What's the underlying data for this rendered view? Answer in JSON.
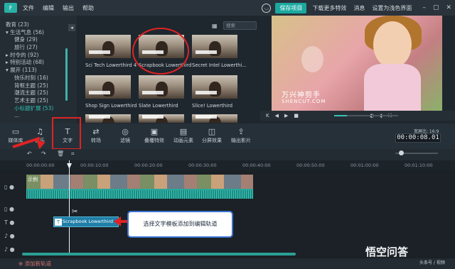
{
  "menubar": {
    "logo": "F",
    "menus": [
      "文件",
      "编辑",
      "输出",
      "帮助"
    ],
    "save_project": "保存项目",
    "download_effects": "下载更多特效",
    "messages": "消息",
    "simple_mode": "设置为浅色界面"
  },
  "sidebar": {
    "collapse_icon": "◂",
    "items": [
      {
        "label": "教育 (23)",
        "indent": 0
      },
      {
        "label": "▾ 生活气息 (56)",
        "indent": 0
      },
      {
        "label": "健身 (29)",
        "indent": 1
      },
      {
        "label": "旅行 (27)",
        "indent": 1
      },
      {
        "label": "▸ 时令的 (92)",
        "indent": 0
      },
      {
        "label": "▸ 特别活动 (68)",
        "indent": 0
      },
      {
        "label": "▾ 展开 (113)",
        "indent": 0
      },
      {
        "label": "快乐时刻 (16)",
        "indent": 1
      },
      {
        "label": "背框主题 (25)",
        "indent": 1
      },
      {
        "label": "潮流主题 (25)",
        "indent": 1
      },
      {
        "label": "艺术主题 (25)",
        "indent": 1
      },
      {
        "label": "小标题扩展 (53)",
        "indent": 1,
        "selected": true
      },
      {
        "label": "...",
        "indent": 1
      }
    ]
  },
  "library": {
    "search_placeholder": "搜索",
    "grid_icon": "▦",
    "thumbnails": [
      {
        "label": "Sci Tech Lowerthird 4"
      },
      {
        "label": "Scrapbook Lowerthird"
      },
      {
        "label": "Secret Intel Lowerthi..."
      },
      {
        "label": "Shop Sign Lowerthird"
      },
      {
        "label": "Slate Lowerthird"
      },
      {
        "label": "Slice! Lowerthird"
      }
    ]
  },
  "preview": {
    "overlay_title": "万兴神剪手",
    "overlay_sub": "SHENCUT.COM",
    "controls": [
      "K",
      "◀",
      "▶",
      "■",
      "▏",
      "◐",
      "◖",
      "⛶"
    ],
    "time_display": "00:00:08.01",
    "ratio": "宽屏比: 16:9"
  },
  "toolbar": {
    "items": [
      {
        "icon": "▭",
        "label": "媒体库"
      },
      {
        "icon": "♫",
        "label": "音乐"
      },
      {
        "icon": "T",
        "label": "文字"
      },
      {
        "icon": "⇄",
        "label": "转场"
      },
      {
        "icon": "◎",
        "label": "滤镜"
      },
      {
        "icon": "▣",
        "label": "叠覆特效"
      },
      {
        "icon": "▤",
        "label": "动画元素"
      },
      {
        "icon": "◫",
        "label": "分屏效果"
      },
      {
        "icon": "⇪",
        "label": "输出影片"
      }
    ]
  },
  "editbar": {
    "undo": "↶",
    "redo": "↷",
    "delete": "🗑",
    "tools": "⌗"
  },
  "ruler": {
    "ticks": [
      "00:00:00:00",
      "00:00:10:00",
      "00:00:20:00",
      "00:00:30:00",
      "00:00:40:00",
      "00:00:50:00",
      "00:01:00:00",
      "00:01:10:00"
    ]
  },
  "timeline": {
    "video_clip_name": "示例",
    "text_clip_name": "Scrapbook Lowerthird",
    "text_clip_icon": "T",
    "callout": "选择文字模板添加到编辑轨道",
    "scissors": "✂",
    "tracks": [
      "▯ ●",
      "▯ ●",
      "T ●",
      "♪ ●",
      "♪ ●"
    ]
  },
  "bottom": {
    "add_track": "⊕ 添加新轨道"
  },
  "watermark": {
    "main": "悟空问答",
    "sub": "头条号 / 视频"
  }
}
